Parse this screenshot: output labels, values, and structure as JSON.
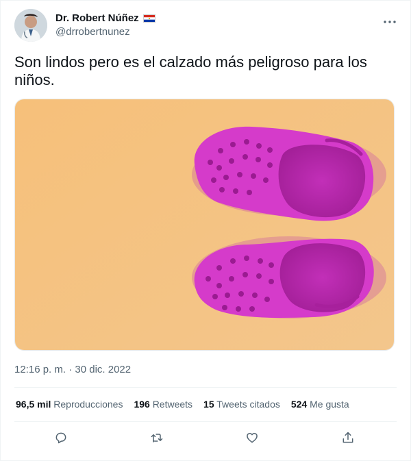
{
  "author": {
    "display_name": "Dr. Robert Núñez",
    "handle": "@drrobertnunez"
  },
  "tweet": {
    "text": "Son lindos pero es el calzado más peligroso para los niños.",
    "timestamp": "12:16 p. m. · 30 dic. 2022"
  },
  "stats": {
    "views_count": "96,5 mil",
    "views_label": "Reproducciones",
    "retweets_count": "196",
    "retweets_label": "Retweets",
    "quotes_count": "15",
    "quotes_label": "Tweets citados",
    "likes_count": "524",
    "likes_label": "Me gusta"
  },
  "icons": {
    "more": "more-dots-icon",
    "reply": "reply-icon",
    "retweet": "retweet-icon",
    "like": "heart-icon",
    "share": "share-icon"
  },
  "colors": {
    "secondary_text": "#536471",
    "media_background": "#f5c27c",
    "clog_pink": "#d23ccb"
  }
}
